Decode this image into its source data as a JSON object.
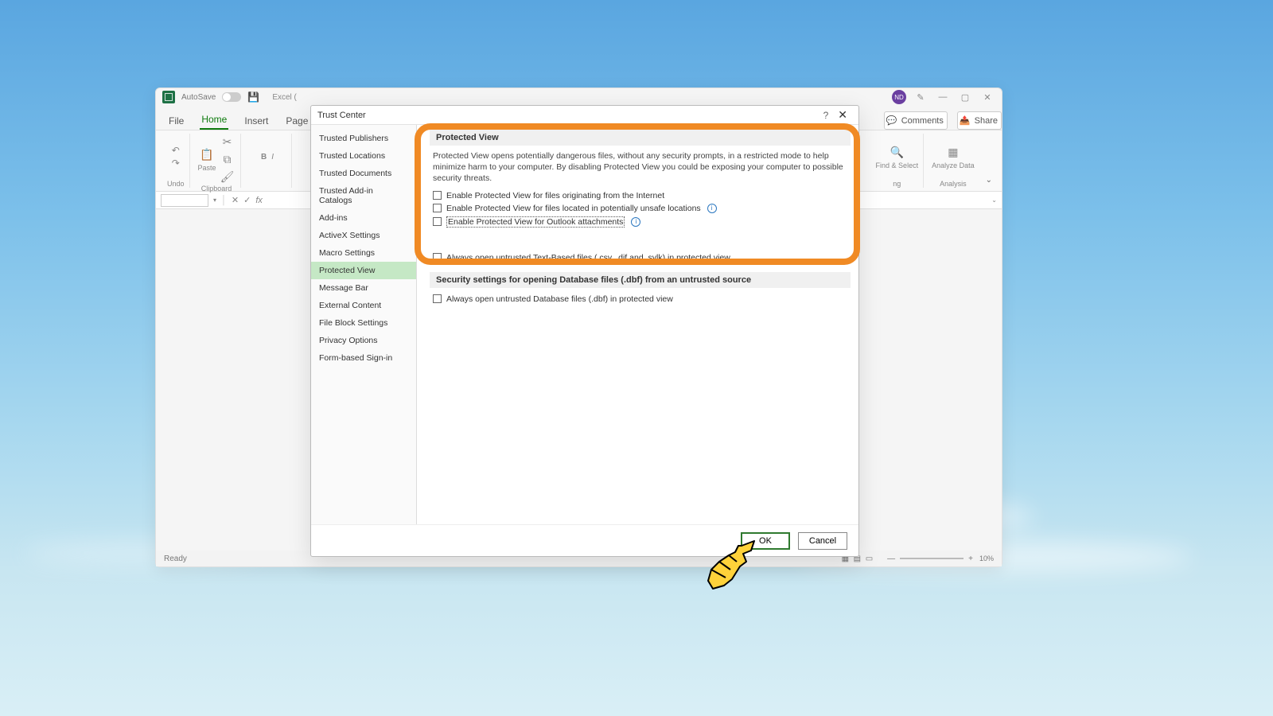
{
  "excel": {
    "autosave_label": "AutoSave",
    "doc_title": "Excel (",
    "avatar_initials": "ND",
    "comments_label": "Comments",
    "share_label": "Share",
    "tabs": {
      "file": "File",
      "home": "Home",
      "insert": "Insert",
      "pagelayout": "Page Lay"
    },
    "groups": {
      "undo": "Undo",
      "clipboard": "Clipboard",
      "analysis": "Analysis"
    },
    "paste_label": "Paste",
    "find_select_label": "Find & Select",
    "analyze_data_label": "Analyze Data",
    "status_ready": "Ready",
    "zoom_pct": "10%"
  },
  "dialog": {
    "title": "Trust Center",
    "sidebar": [
      "Trusted Publishers",
      "Trusted Locations",
      "Trusted Documents",
      "Trusted Add-in Catalogs",
      "Add-ins",
      "ActiveX Settings",
      "Macro Settings",
      "Protected View",
      "Message Bar",
      "External Content",
      "File Block Settings",
      "Privacy Options",
      "Form-based Sign-in"
    ],
    "selected_index": 7,
    "protected_view": {
      "section_title": "Protected View",
      "description": "Protected View opens potentially dangerous files, without any security prompts, in a restricted mode to help minimize harm to your computer. By disabling Protected View you could be exposing your computer to possible security threats.",
      "chk1": "Enable Protected View for files originating from the Internet",
      "chk2": "Enable Protected View for files located in potentially unsafe locations",
      "chk3": "Enable Protected View for Outlook attachments"
    },
    "text_files": {
      "chk": "Always open untrusted Text-Based files (.csv, .dif and .sylk) in protected view"
    },
    "dbf": {
      "section_title": "Security settings for opening Database files (.dbf) from an untrusted source",
      "chk": "Always open untrusted Database files (.dbf) in protected view"
    },
    "ok_label": "OK",
    "cancel_label": "Cancel"
  }
}
